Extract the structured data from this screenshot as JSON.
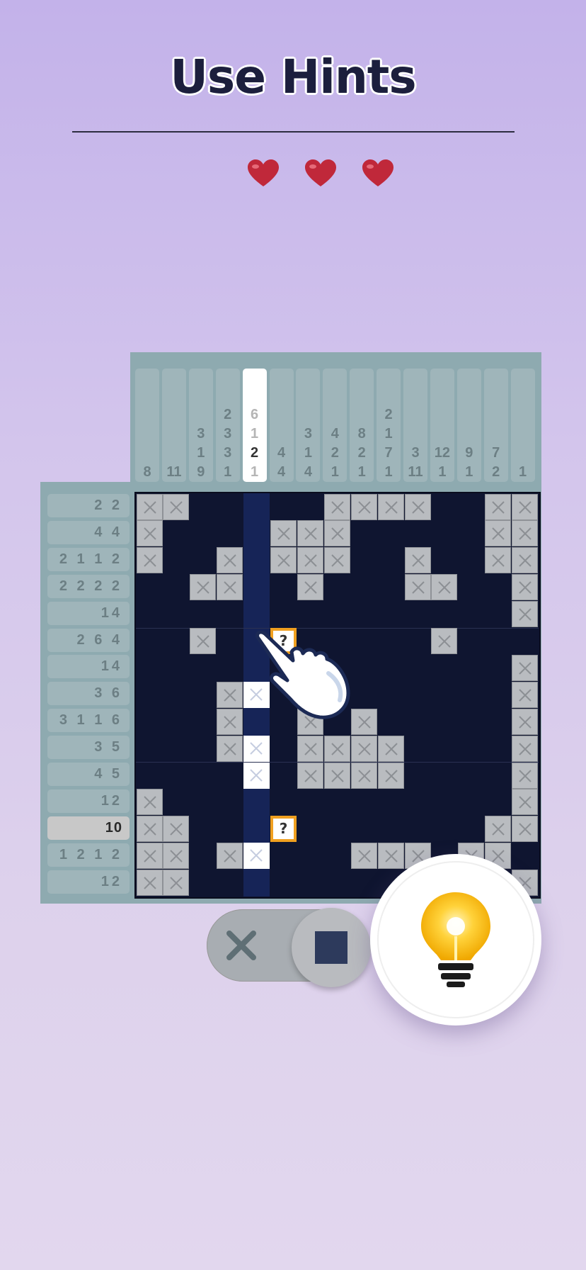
{
  "header": {
    "title": "Use Hints"
  },
  "lives": {
    "count": 3,
    "color": "#c0283a"
  },
  "puzzle": {
    "size": 15,
    "column_clues": [
      [
        "8"
      ],
      [
        "11"
      ],
      [
        "3",
        "1",
        "9"
      ],
      [
        "2",
        "3",
        "3",
        "1"
      ],
      [
        "6",
        "1",
        "2",
        "1"
      ],
      [
        "4",
        "4"
      ],
      [
        "3",
        "1",
        "4"
      ],
      [
        "4",
        "2",
        "1"
      ],
      [
        "8",
        "2",
        "1"
      ],
      [
        "2",
        "1",
        "7",
        "1"
      ],
      [
        "3",
        "11"
      ],
      [
        "12",
        "1"
      ],
      [
        "9",
        "1"
      ],
      [
        "7",
        "2"
      ],
      [
        "1"
      ]
    ],
    "active_column": 4,
    "active_column_current_clue": 2,
    "row_clues": [
      "2 2",
      "4 4",
      "2 1 1 2",
      "2 2 2 2",
      "14",
      "2 6 4",
      "14",
      "3 6",
      "3 1 1 6",
      "3 5",
      "4 5",
      "12",
      "10",
      "1 2 1 2",
      "12"
    ],
    "active_row": 12,
    "grid": [
      "XX.....XXXX..XXXX",
      "X....XXX.....XXX",
      "X..X.XXX..X..XXX",
      "..XX..X...XX..XX",
      "..............X",
      "..X..Q.....X...X",
      "..............X",
      "...XH.X.......X",
      "...X..X.X.....X",
      "...XH.XXXX....X",
      "....H.XXXX....X",
      "X.............XX",
      "XX...Q.......XXX",
      "XX.XH...XXX.XX..",
      "XX............X"
    ]
  },
  "controls": {
    "mode_cross_icon": "cross-icon",
    "mode_fill_icon": "filled-square-icon",
    "selected_mode": "fill",
    "hint_icon": "lightbulb-icon",
    "hint_question_mark": "?"
  }
}
